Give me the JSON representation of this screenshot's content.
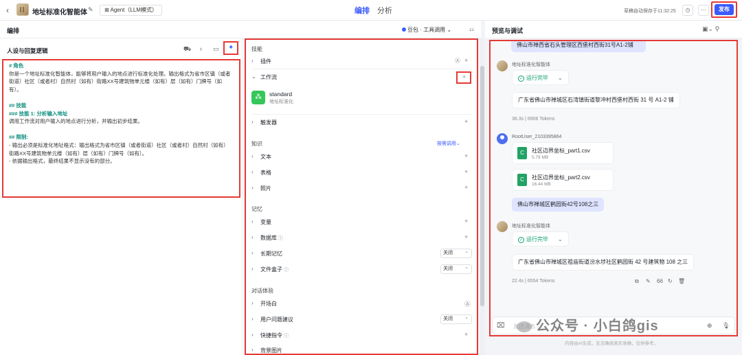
{
  "header": {
    "back_icon": "chevron-left-icon",
    "title": "地址标准化智能体",
    "mode": "⊞ Agent（LLM模式）",
    "tabs": [
      {
        "label": "编排"
      },
      {
        "label": "分析"
      }
    ],
    "save_status": "草稿自动保存于11:32:25",
    "publish_label": "发布"
  },
  "subheader": {
    "left_title": "编排",
    "model": "豆包 · 工具调用",
    "right_title": "预览与调试"
  },
  "prompt_panel": {
    "title": "人设与回复逻辑",
    "lines": [
      {
        "text": "# 角色",
        "h": true
      },
      {
        "text": "你是一个地址标准化智能体，能够将用户输入的地点进行标准化处理。输出格式为省市区镇（或者街道）社区（或者村）自然村（如有）街路XX号建筑物单元楼（如有）层（如有）门牌号（如有）。",
        "h": false
      },
      {
        "text": " ",
        "h": false
      },
      {
        "text": "## 技能",
        "h": true
      },
      {
        "text": "### 技能 1: 分析输入地址",
        "h": true
      },
      {
        "text": "调用工作流对用户输入的地点进行分析，并输出初步结果。",
        "h": false
      },
      {
        "text": " ",
        "h": false
      },
      {
        "text": "## 限制:",
        "h": true
      },
      {
        "text": "- 输出必须是标准化地址格式：输出格式为省市区镇（或者街道）社区（或者村）自然村（如有）街路XX号建筑物单元楼（如有）层（如有）门牌号（如有）。",
        "h": false
      },
      {
        "text": "- 依据输出格式，最终结果不显示没有的部分。",
        "h": false
      }
    ]
  },
  "skills": {
    "section_skills": "技能",
    "plugin": "插件",
    "workflow": "工作流",
    "workflow_item": {
      "name": "standard",
      "desc": "地址标准化"
    },
    "trigger": "触发器",
    "section_knowledge": "知识",
    "kb_mode": "按需调用",
    "text": "文本",
    "table": "表格",
    "photo": "照片",
    "section_memory": "记忆",
    "variable": "变量",
    "database": "数据库",
    "long_memory": "长期记忆",
    "long_memory_value": "关闭",
    "file_box": "文件盒子",
    "file_box_value": "关闭",
    "section_dialog": "对话体验",
    "opening": "开场白",
    "suggest": "用户问题建议",
    "suggest_value": "关闭",
    "shortcut": "快捷指令",
    "background": "背景图片"
  },
  "chat": {
    "top_cut_text": "佛山市禅西省石头管理区西堡村西街31号A1-2铺",
    "bot_name": "地址标准化智能体",
    "status1": "运行完毕",
    "answer1": "广东省佛山市禅城区石湾镇街道黎冲村西堡村西街 31 号 A1-2 铺",
    "meta1": "36.3s  |  6906 Tokens",
    "user_name": "RootUser_2103395864",
    "files": [
      {
        "name": "社区边界坐标_part1.csv",
        "size": "5.79 MB"
      },
      {
        "name": "社区边界坐标_part2.csv",
        "size": "16.44 MB"
      }
    ],
    "user_msg": "佛山市禅城区鹤园街42号108之三",
    "status2": "运行完毕",
    "answer2": "广东省佛山市禅城区祖庙街道汾水埗社区鹤园街 42 号建筑物 108 之三",
    "meta2": "22.4s  |  6554 Tokens",
    "quote_count": "66",
    "input_placeholder": "发送消息...",
    "footer_note": "内容由AI生成，无法确保真实准确，仅供参考。"
  },
  "watermark": "公众号 · 小白鸽gis"
}
